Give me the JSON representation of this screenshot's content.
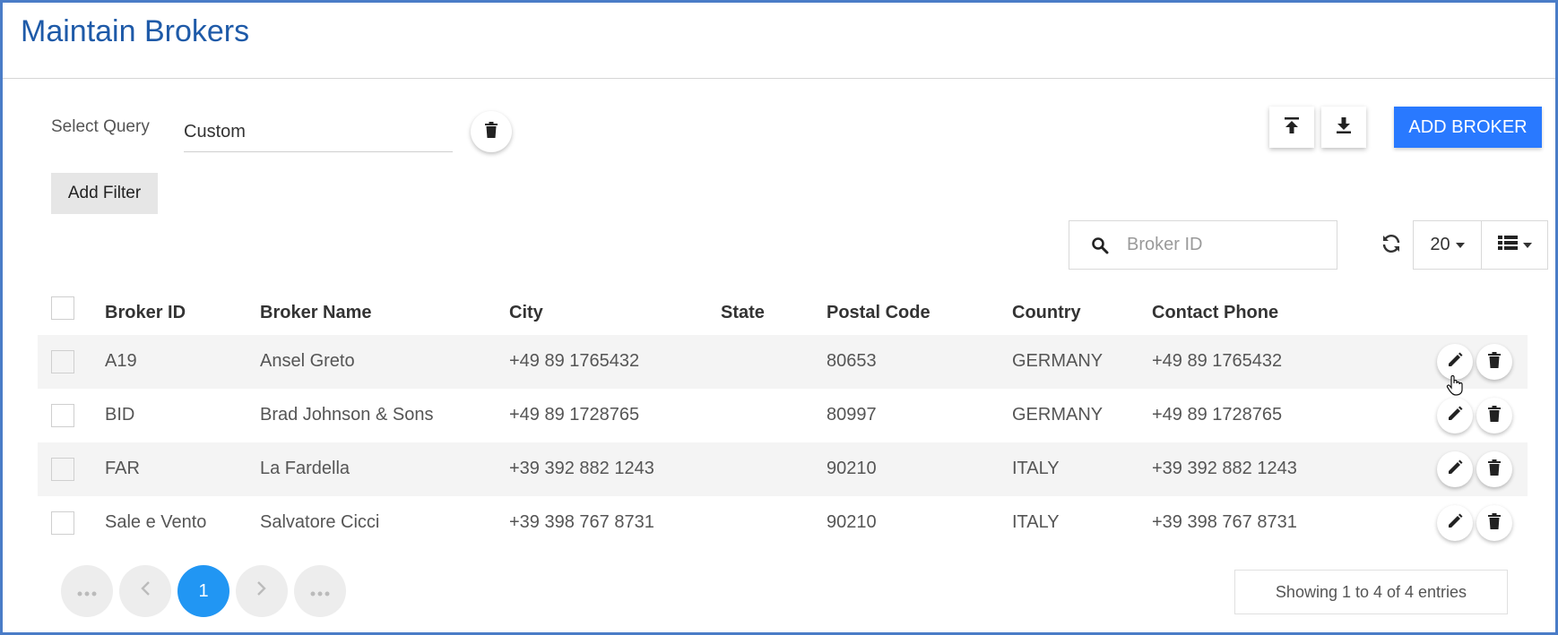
{
  "page": {
    "title": "Maintain Brokers"
  },
  "query": {
    "label": "Select Query",
    "value": "Custom"
  },
  "toolbar": {
    "add_broker_label": "ADD BROKER",
    "add_filter_label": "Add Filter"
  },
  "search": {
    "placeholder": "Broker ID"
  },
  "page_size": {
    "value": "20"
  },
  "table": {
    "headers": [
      "Broker ID",
      "Broker Name",
      "City",
      "State",
      "Postal Code",
      "Country",
      "Contact Phone"
    ],
    "rows": [
      {
        "broker_id": "A19",
        "broker_name": "Ansel Greto",
        "city": "+49 89 1765432",
        "state": "",
        "postal_code": "80653",
        "country": "GERMANY",
        "contact_phone": "+49 89 1765432"
      },
      {
        "broker_id": "BID",
        "broker_name": "Brad Johnson & Sons",
        "city": "+49 89 1728765",
        "state": "",
        "postal_code": "80997",
        "country": "GERMANY",
        "contact_phone": "+49 89 1728765"
      },
      {
        "broker_id": "FAR",
        "broker_name": "La Fardella",
        "city": "+39 392 882 1243",
        "state": "",
        "postal_code": "90210",
        "country": "ITALY",
        "contact_phone": "+39 392 882 1243"
      },
      {
        "broker_id": "Sale e Vento",
        "broker_name": "Salvatore Cicci",
        "city": "+39 398 767 8731",
        "state": "",
        "postal_code": "90210",
        "country": "ITALY",
        "contact_phone": "+39 398 767 8731"
      }
    ]
  },
  "pagination": {
    "current_page": "1",
    "first_icon": "ellipsis-icon",
    "prev_icon": "chevron-left-icon",
    "next_icon": "chevron-right-icon",
    "last_icon": "ellipsis-icon"
  },
  "footer": {
    "entries_text": "Showing 1 to 4 of 4 entries"
  },
  "colors": {
    "title": "#1e5aa8",
    "primary_button": "#2979ff",
    "active_page": "#2196f3",
    "frame_border": "#4a7cc7"
  }
}
